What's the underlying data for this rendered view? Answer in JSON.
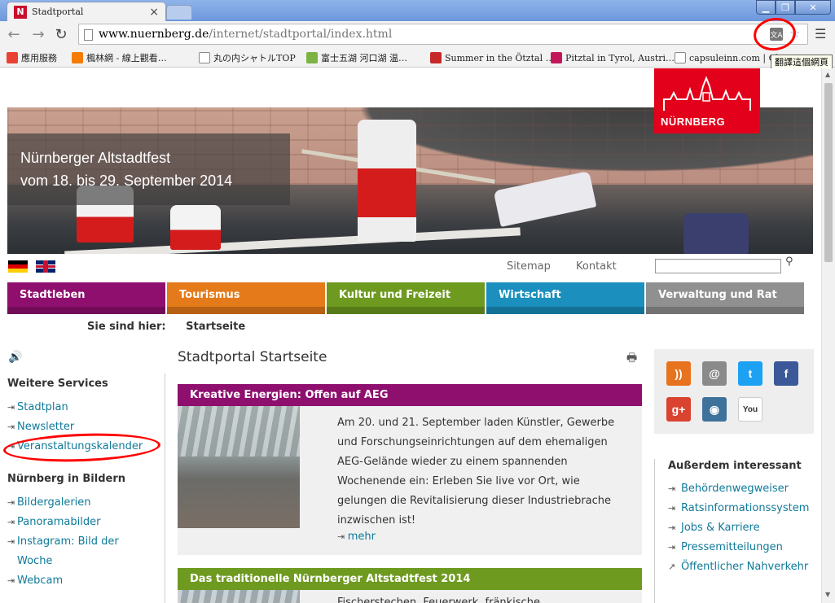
{
  "browser": {
    "tab_title": "Stadtportal",
    "tab_favicon": "N",
    "tab_close": "×",
    "url_host": "www.nuernberg.de",
    "url_path": "/internet/stadtportal/index.html",
    "translate_tooltip": "翻譯這個網頁",
    "bookmarks": [
      {
        "label": "應用服務",
        "icon": "apps-grid-icon",
        "color": "#e94235"
      },
      {
        "label": "楓林網 - 線上觀看…",
        "icon": "blogger-icon",
        "color": "#f57c00"
      },
      {
        "label": "丸の内シャトルTOP",
        "icon": "page-icon",
        "color": "#ffffff"
      },
      {
        "label": "富士五湖 河口湖 温…",
        "icon": "frog-icon",
        "color": "#7cb342"
      },
      {
        "label": "Summer in the Ötztal …",
        "icon": "oetztal-icon",
        "color": "#c62828"
      },
      {
        "label": "Pitztal in Tyrol, Austri…",
        "icon": "pitztal-icon",
        "color": "#c2185b"
      },
      {
        "label": "capsuleinn.com | Cl",
        "icon": "page-icon",
        "color": "#ffffff"
      }
    ]
  },
  "site": {
    "logo_text": "NÜRNBERG",
    "hero_caption_line1": "Nürnberger Altstadtfest",
    "hero_caption_line2": "vom 18. bis 29. September 2014",
    "top_links": [
      "Sitemap",
      "Kontakt"
    ],
    "nav": [
      {
        "label": "Stadtleben",
        "color": "#8f0f6e"
      },
      {
        "label": "Tourismus",
        "color": "#e57a1a"
      },
      {
        "label": "Kultur und Freizeit",
        "color": "#6e9a20"
      },
      {
        "label": "Wirtschaft",
        "color": "#1b8fbd"
      },
      {
        "label": "Verwaltung und Rat",
        "color": "#909090"
      }
    ],
    "breadcrumb_label": "Sie sind hier:",
    "breadcrumb_current": "Startseite",
    "page_heading": "Stadtportal Startseite",
    "left": {
      "services_heading": "Weitere Services",
      "services": [
        "Stadtplan",
        "Newsletter",
        "Veranstaltungskalender"
      ],
      "pictures_heading": "Nürnberg in Bildern",
      "pictures": [
        "Bildergalerien",
        "Panoramabilder",
        "Instagram: Bild der",
        "Woche",
        "Webcam"
      ]
    },
    "articles": [
      {
        "title": "Kreative Energien: Offen auf AEG",
        "color": "#8f0f6e",
        "lines": [
          "Am 20. und 21. September laden Künstler, Gewerbe",
          "und Forschungseinrichtungen auf dem ehemaligen",
          "AEG-Gelände wieder zu einem spannenden",
          "Wochenende ein: Erleben Sie live vor Ort, wie",
          "gelungen die Revitalisierung dieser Industriebrache",
          "inzwischen ist!"
        ],
        "more": "mehr"
      },
      {
        "title": "Das traditionelle Nürnberger Altstadtfest 2014",
        "color": "#6e9a20",
        "lines": [
          "Fischerstechen, Feuerwerk, fränkische"
        ]
      }
    ],
    "social_icons": [
      {
        "name": "rss-icon",
        "glyph": "))",
        "color": "#e8731e"
      },
      {
        "name": "newsletter-icon",
        "glyph": "@",
        "color": "#8a8a8a"
      },
      {
        "name": "twitter-icon",
        "glyph": "t",
        "color": "#1da1f2"
      },
      {
        "name": "facebook-icon",
        "glyph": "f",
        "color": "#3b5998"
      },
      {
        "name": "google-plus-icon",
        "glyph": "g+",
        "color": "#d9432f"
      },
      {
        "name": "instagram-icon",
        "glyph": "◉",
        "color": "#3f729b"
      },
      {
        "name": "youtube-icon",
        "glyph": "You",
        "color": "#ffffff"
      }
    ],
    "right": {
      "heading": "Außerdem interessant",
      "links": [
        "Behördenwegweiser",
        "Ratsinformationssystem",
        "Jobs & Karriere",
        "Pressemitteilungen",
        "Öffentlicher Nahverkehr"
      ]
    }
  }
}
